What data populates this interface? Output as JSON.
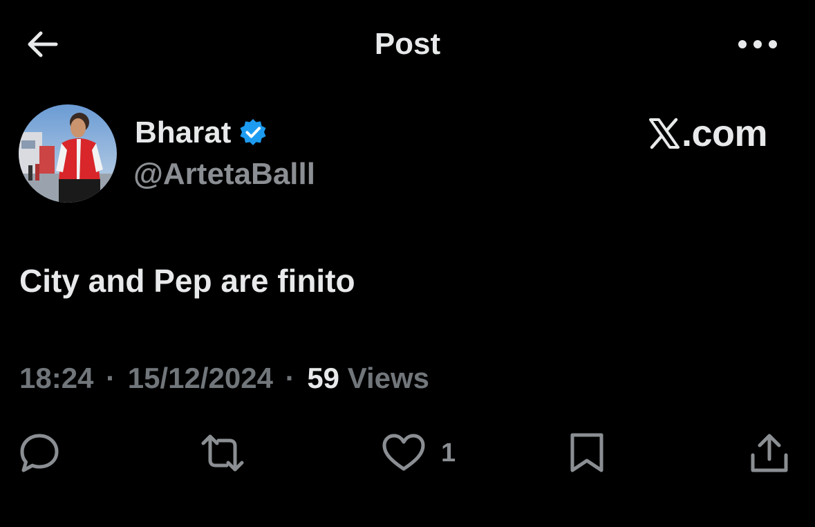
{
  "header": {
    "title": "Post",
    "back_icon": "arrow-left-icon",
    "more_icon": "more-horizontal-icon"
  },
  "author": {
    "name": "Bharat",
    "handle": "@ArtetaBalll",
    "verified": true,
    "verified_color": "#1d9bf0"
  },
  "brand": {
    "logo": "X",
    "text": ".com"
  },
  "post": {
    "text": "City and Pep are finito"
  },
  "meta": {
    "time": "18:24",
    "separator": "·",
    "date": "15/12/2024",
    "views_count": "59",
    "views_label": "Views"
  },
  "actions": {
    "reply_icon": "reply-icon",
    "repost_icon": "repost-icon",
    "like_icon": "heart-icon",
    "like_count": "1",
    "bookmark_icon": "bookmark-icon",
    "share_icon": "share-icon"
  },
  "colors": {
    "background": "#000000",
    "text_primary": "#e7e9ea",
    "text_secondary": "#71767b",
    "accent": "#1d9bf0"
  }
}
